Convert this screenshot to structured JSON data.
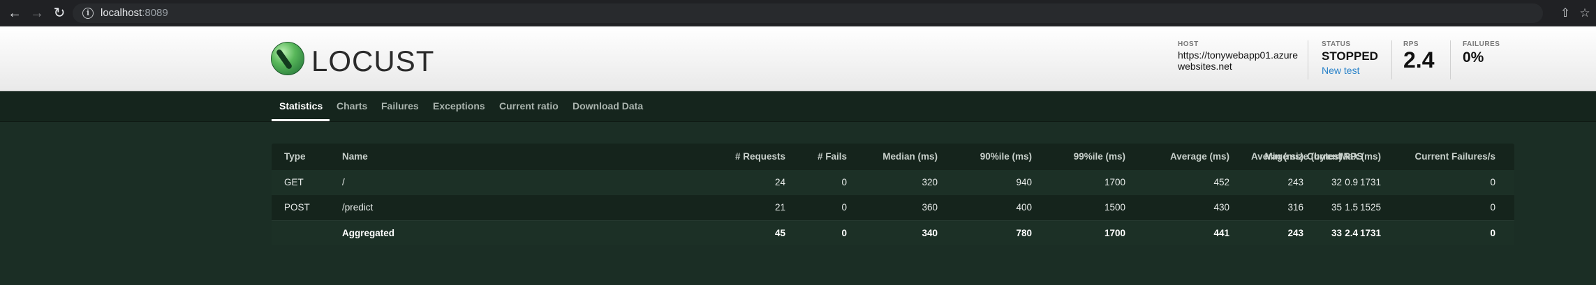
{
  "browser": {
    "url_host": "localhost",
    "url_port": ":8089",
    "back_icon": "arrow-left",
    "forward_icon": "arrow-right",
    "reload_icon": "reload",
    "info_icon": "info-circle",
    "share_icon": "share",
    "bookmark_icon": "star"
  },
  "header": {
    "logo_text": "LOCUST",
    "host_label": "HOST",
    "host_value": "https://tonywebapp01.azurewebsites.net",
    "status_label": "STATUS",
    "status_value": "STOPPED",
    "new_test_label": "New test",
    "rps_label": "RPS",
    "rps_value": "2.4",
    "failures_label": "FAILURES",
    "failures_value": "0%"
  },
  "tabs": [
    {
      "label": "Statistics",
      "active": true
    },
    {
      "label": "Charts"
    },
    {
      "label": "Failures"
    },
    {
      "label": "Exceptions"
    },
    {
      "label": "Current ratio"
    },
    {
      "label": "Download Data"
    }
  ],
  "table": {
    "columns": [
      "Type",
      "Name",
      "# Requests",
      "# Fails",
      "Median (ms)",
      "90%ile (ms)",
      "99%ile (ms)",
      "Average (ms)",
      "Min (ms)",
      "Max (ms)",
      "Average size (bytes)",
      "Current RPS",
      "Current Failures/s"
    ],
    "rows": [
      [
        "GET",
        "/",
        "24",
        "0",
        "320",
        "940",
        "1700",
        "452",
        "243",
        "1731",
        "32",
        "0.9",
        "0"
      ],
      [
        "POST",
        "/predict",
        "21",
        "0",
        "360",
        "400",
        "1500",
        "430",
        "316",
        "1525",
        "35",
        "1.5",
        "0"
      ]
    ],
    "aggregated": [
      "",
      "Aggregated",
      "45",
      "0",
      "340",
      "780",
      "1700",
      "441",
      "243",
      "1731",
      "33",
      "2.4",
      "0"
    ]
  },
  "colors": {
    "page_bg": "#1b2e25",
    "tabs_bg": "#15251d",
    "table_bg": "#15241c",
    "link": "#2a83c9"
  }
}
